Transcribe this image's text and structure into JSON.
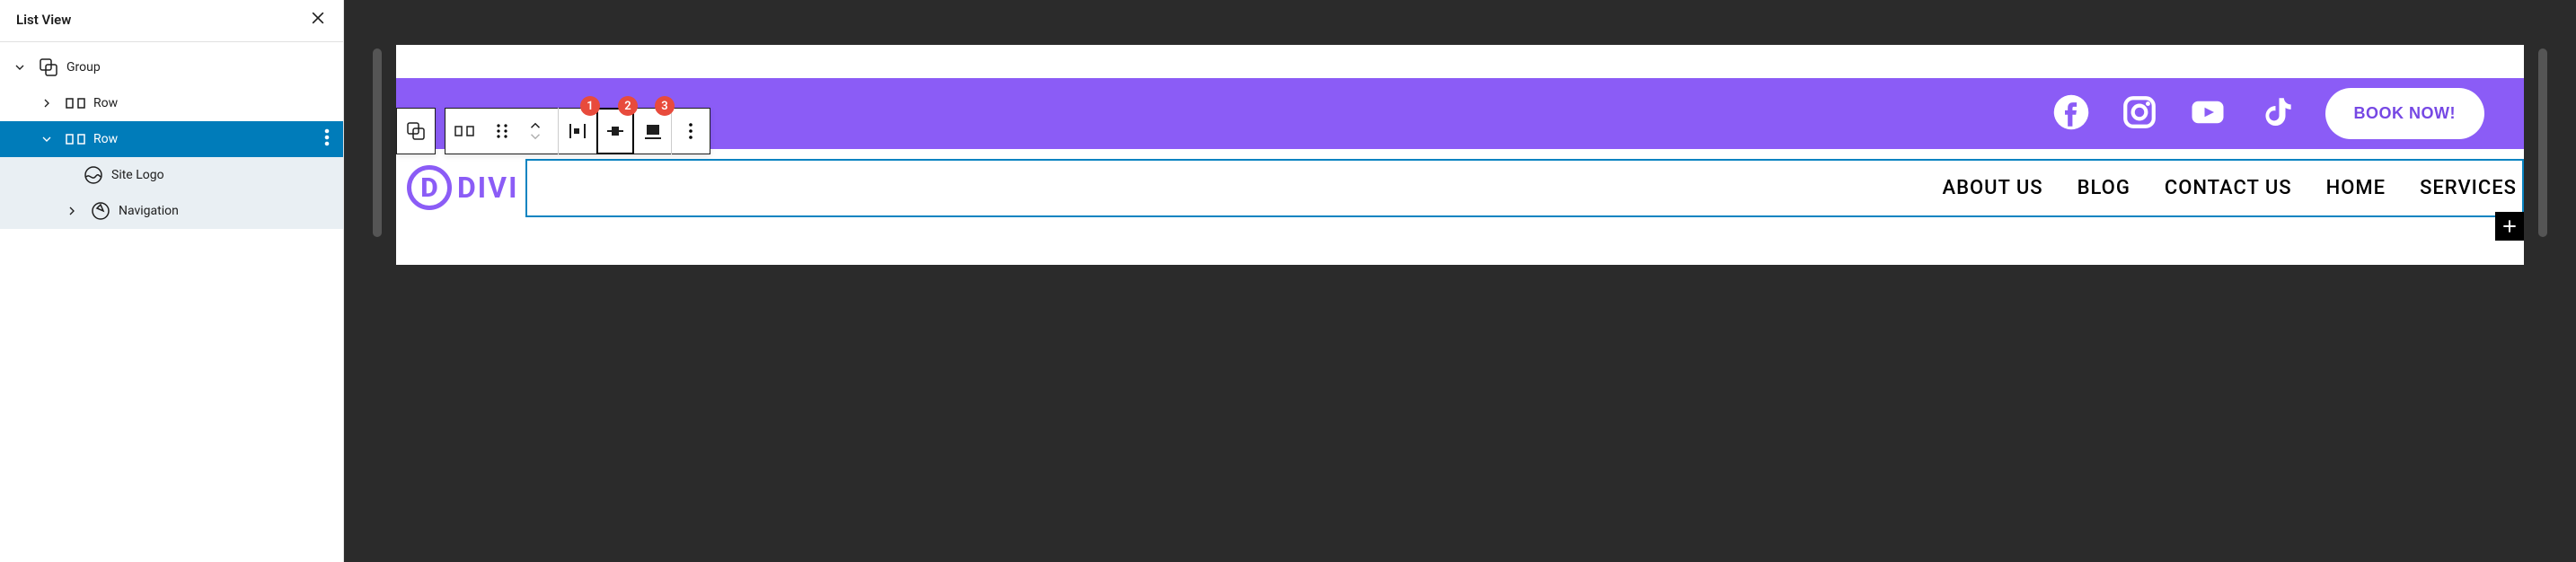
{
  "sidebar": {
    "title": "List View",
    "tree": {
      "group": "Group",
      "row1": "Row",
      "row2": "Row",
      "siteLogo": "Site Logo",
      "navigation": "Navigation"
    }
  },
  "toolbar": {
    "badges": {
      "justify": "1",
      "align": "2",
      "full": "3"
    }
  },
  "topbar": {
    "cta": "BOOK NOW!"
  },
  "logo": {
    "letter": "D",
    "text": "DIVI"
  },
  "nav": {
    "items": [
      "ABOUT US",
      "BLOG",
      "CONTACT US",
      "HOME",
      "SERVICES"
    ]
  }
}
